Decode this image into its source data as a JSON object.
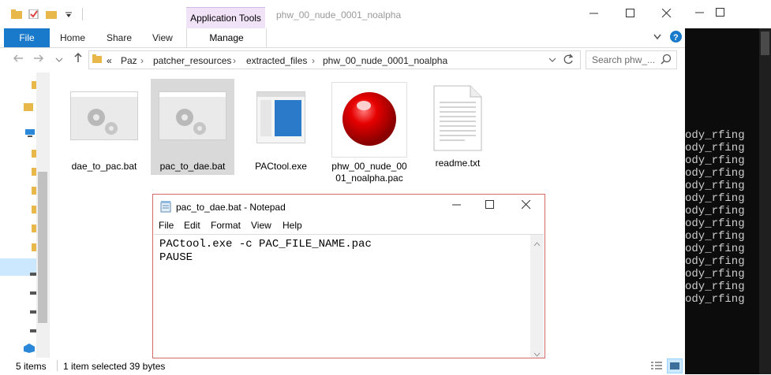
{
  "explorer": {
    "window_title": "phw_00_nude_0001_noalpha",
    "contextual_group": "Application Tools",
    "tabs": [
      "File",
      "Home",
      "Share",
      "View",
      "Manage"
    ],
    "breadcrumb": [
      "«",
      "Paz",
      "patcher_resources",
      "extracted_files",
      "phw_00_nude_0001_noalpha"
    ],
    "search_placeholder": "Search phw_...",
    "files": [
      {
        "name": "dae_to_pac.bat",
        "icon": "bat-gears-icon"
      },
      {
        "name": "pac_to_dae.bat",
        "icon": "bat-gears-icon",
        "selected": true
      },
      {
        "name": "PACtool.exe",
        "icon": "exe-window-icon"
      },
      {
        "name": "phw_00_nude_00\n01_noalpha.pac",
        "icon": "red-sphere-icon"
      },
      {
        "name": "readme.txt",
        "icon": "text-file-icon"
      }
    ],
    "status": {
      "count": "5 items",
      "selection": "1 item selected",
      "size": "39 bytes"
    }
  },
  "console": {
    "lines": [
      "ody_rfing",
      "ody_rfing",
      "ody_rfing",
      "ody_rfing",
      "ody_rfing",
      "ody_rfing",
      "ody_rfing",
      "ody_rfing",
      "ody_rfing",
      "ody_rfing",
      "ody_rfing",
      "ody_rfing",
      "ody_rfing",
      "ody_rfing"
    ]
  },
  "notepad": {
    "title": "pac_to_dae.bat - Notepad",
    "menu": [
      "File",
      "Edit",
      "Format",
      "View",
      "Help"
    ],
    "content": "PACtool.exe -c PAC_FILE_NAME.pac\nPAUSE"
  },
  "colors": {
    "accent": "#1979ca",
    "apptools": "#f0e2f7",
    "selection": "#d9d9d9",
    "notepad_border": "#d46a6a"
  }
}
